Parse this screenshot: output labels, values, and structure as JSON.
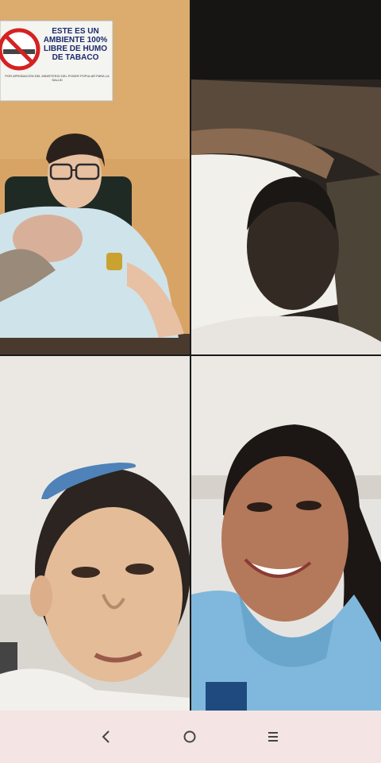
{
  "call": {
    "participants": [
      {
        "label": "participant-1"
      },
      {
        "label": "participant-2"
      },
      {
        "label": "participant-3"
      },
      {
        "label": "participant-4"
      }
    ],
    "sign": {
      "title_lines": "ESTE ES UN AMBIENTE 100% LIBRE DE HUMO DE TABACO",
      "footer": "POR APROBACIÓN DEL MINISTERIO DEL PODER POPULAR PARA LA SALUD"
    }
  },
  "navbar": {
    "back_icon": "chevron-left-icon",
    "home_icon": "circle-home-icon",
    "recents_icon": "menu-lines-icon"
  },
  "colors": {
    "navbar_bg": "#f4e4e4",
    "nav_icon": "#444444"
  }
}
